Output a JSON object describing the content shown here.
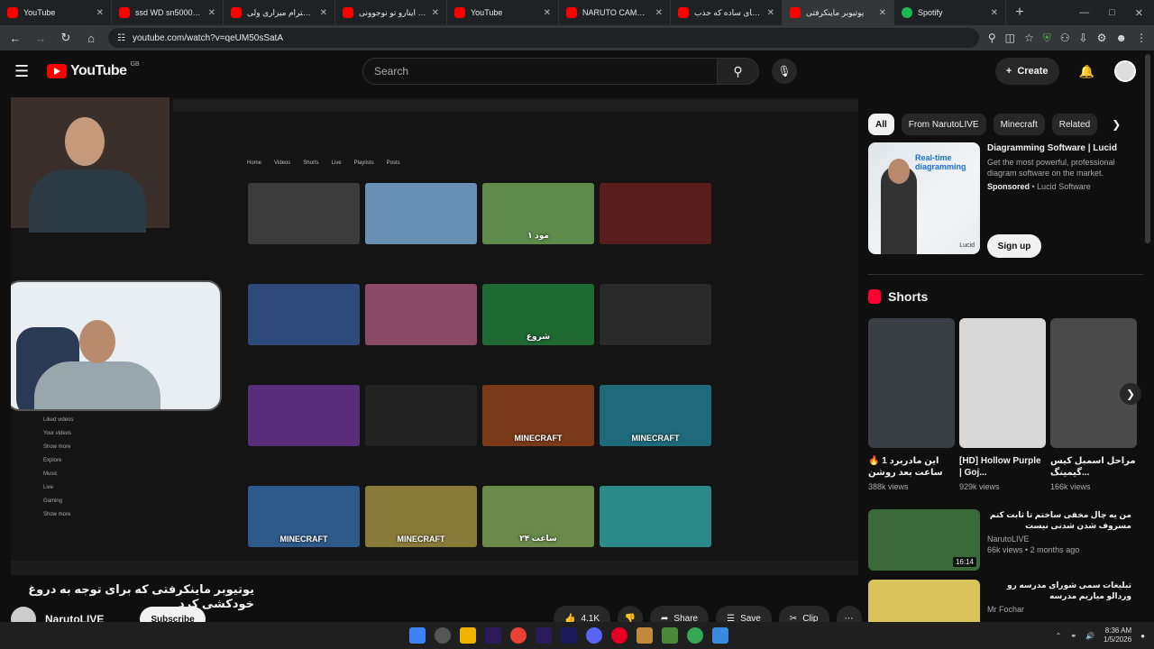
{
  "browser": {
    "tabs": [
      {
        "title": "YouTube",
        "active": false
      },
      {
        "title": "ssd WD sn5000 😅 I",
        "active": false
      },
      {
        "title": "اگر احترام میزاری ولی",
        "active": false
      },
      {
        "title": "کاش اینارو تو نوجوونی",
        "active": false
      },
      {
        "title": "YouTube",
        "active": false
      },
      {
        "title": "NARUTO CAME TO T",
        "active": false
      },
      {
        "title": "تمرینای ساده که جذب",
        "active": false
      },
      {
        "title": "یوتیوبر ماینکرفتی",
        "active": true
      },
      {
        "title": "Spotify",
        "active": false
      }
    ],
    "url": "youtube.com/watch?v=qeUM50sSatA"
  },
  "header": {
    "logo_text": "YouTube",
    "region": "GB",
    "search_placeholder": "Search",
    "create_label": "Create"
  },
  "video": {
    "title": "یوتیوبر ماینکرفتی که برای توجه به دروغ خودکشی کرد",
    "channel": "NarutoLIVE",
    "subscribe_label": "Subscribe",
    "likes": "4.1K",
    "share_label": "Share",
    "save_label": "Save",
    "clip_label": "Clip"
  },
  "inner_screen": {
    "nav_tabs": [
      "Home",
      "Videos",
      "Shorts",
      "Live",
      "Playlists",
      "Posts"
    ],
    "sidebar_items": [
      "Liked videos",
      "Your videos",
      "Show more",
      "Explore",
      "Music",
      "Live",
      "Gaming",
      "Show more"
    ],
    "thumbnails": [
      {
        "overlay": "",
        "color": "#3b3b3b"
      },
      {
        "overlay": "",
        "color": "#6a8fb5"
      },
      {
        "overlay": "۱ مود",
        "color": "#5d8c4a"
      },
      {
        "overlay": "",
        "color": "#5a1d1d"
      },
      {
        "overlay": "",
        "color": "#2d4a7a"
      },
      {
        "overlay": "",
        "color": "#8a4a66"
      },
      {
        "overlay": "شروع",
        "color": "#1f6a32"
      },
      {
        "overlay": "",
        "color": "#2a2a2a"
      },
      {
        "overlay": "",
        "color": "#5a2d7a"
      },
      {
        "overlay": "",
        "color": "#222222"
      },
      {
        "overlay": "MINECRAFT",
        "color": "#7a3a1a"
      },
      {
        "overlay": "MINECRAFT",
        "color": "#1f6a7a"
      },
      {
        "overlay": "MINECRAFT",
        "color": "#2d5a8a"
      },
      {
        "overlay": "MINECRAFT",
        "color": "#8a7a3a"
      },
      {
        "overlay": "۲۴ ساعت",
        "color": "#6a8a4a"
      },
      {
        "overlay": "",
        "color": "#2d8a8a"
      }
    ]
  },
  "sidebar": {
    "chips": [
      "All",
      "From NarutoLIVE",
      "Minecraft",
      "Related"
    ],
    "ad": {
      "thumb_text": "Real-time diagramming",
      "brand_mark": "Lucid",
      "title": "Diagramming Software | Lucid",
      "description": "Get the most powerful, professional diagram software on the market.",
      "sponsored": "Sponsored",
      "advertiser": "Lucid Software",
      "cta": "Sign up"
    },
    "shorts_heading": "Shorts",
    "shorts": [
      {
        "title": "این مادربرد 1 🔥 ساعت بعد روشن",
        "views": "388k views",
        "color": "#3a3f45"
      },
      {
        "title": "[HD] Hollow Purple | Goj...",
        "views": "929k views",
        "color": "#d8d8d8"
      },
      {
        "title": "مراحل اسمبل کیس گیمینگ...",
        "views": "166k views",
        "color": "#4a4a4a"
      }
    ],
    "recommendations": [
      {
        "title": "من یه چال مخفی ساختم تا ثابت کنم مسروف شدن شدنی نیست",
        "channel": "NarutoLIVE",
        "meta": "66k views • 2 months ago",
        "duration": "16:14",
        "color": "#3a6a3a"
      },
      {
        "title": "تبلیغات سمی شورای مدرسه رو وردالو میاریم مدرسه",
        "channel": "Mr Fochar",
        "meta": "",
        "duration": "",
        "color": "#d8c45a"
      }
    ]
  },
  "taskbar": {
    "time": "8:36 AM",
    "date": "1/5/2026"
  }
}
